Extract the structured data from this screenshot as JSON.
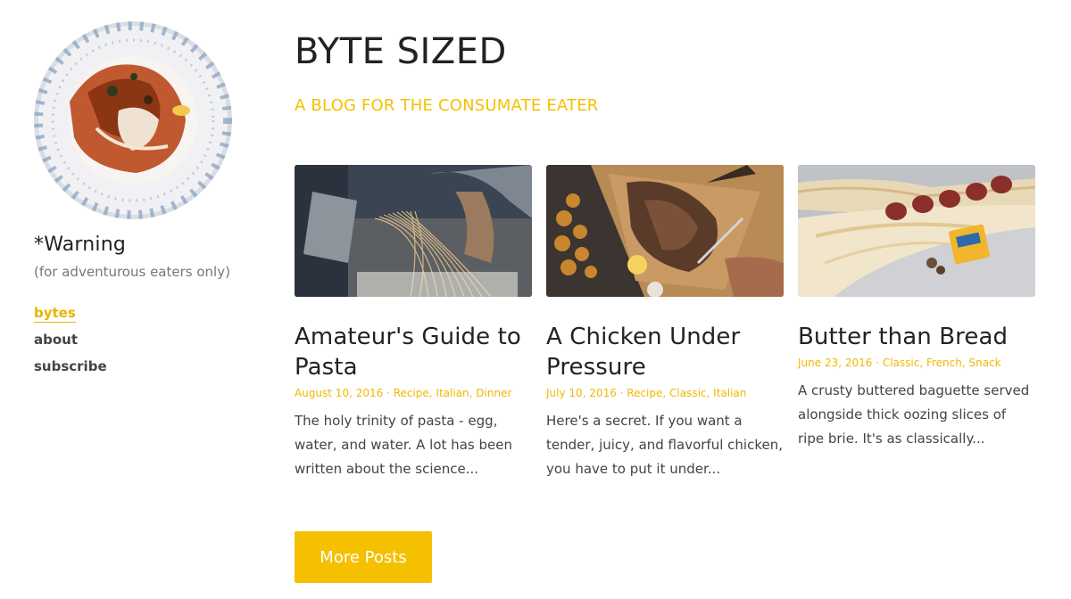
{
  "sidebar": {
    "site_name": "*Warning",
    "tagline": "(for adventurous eaters only)",
    "nav": [
      {
        "label": "bytes",
        "active": true
      },
      {
        "label": "about",
        "active": false
      },
      {
        "label": "subscribe",
        "active": false
      }
    ]
  },
  "header": {
    "title": "BYTE SIZED",
    "subtitle": "A BLOG FOR THE CONSUMATE EATER"
  },
  "posts": [
    {
      "title": "Amateur's Guide to Pasta",
      "date": "August 10, 2016",
      "tags": "Recipe, Italian, Dinner",
      "meta": "August 10, 2016 · Recipe, Italian, Dinner",
      "excerpt": "The holy trinity of pasta - egg, water, and water. A lot has been written about the science..."
    },
    {
      "title": "A Chicken Under Pressure",
      "date": "July 10, 2016",
      "tags": "Recipe, Classic, Italian",
      "meta": "July 10, 2016 · Recipe, Classic, Italian",
      "excerpt": "Here's a secret. If you want a tender, juicy, and flavorful chicken, you have to put it under..."
    },
    {
      "title": "Butter than Bread",
      "date": "June 23, 2016",
      "tags": "Classic, French, Snack",
      "meta": "June 23, 2016 · Classic, French, Snack",
      "excerpt": "A crusty buttered baguette served alongside thick oozing slices of ripe brie. It's as classically..."
    }
  ],
  "more_button": "More Posts",
  "colors": {
    "accent": "#f5c000",
    "text": "#222222",
    "muted": "#777777"
  }
}
